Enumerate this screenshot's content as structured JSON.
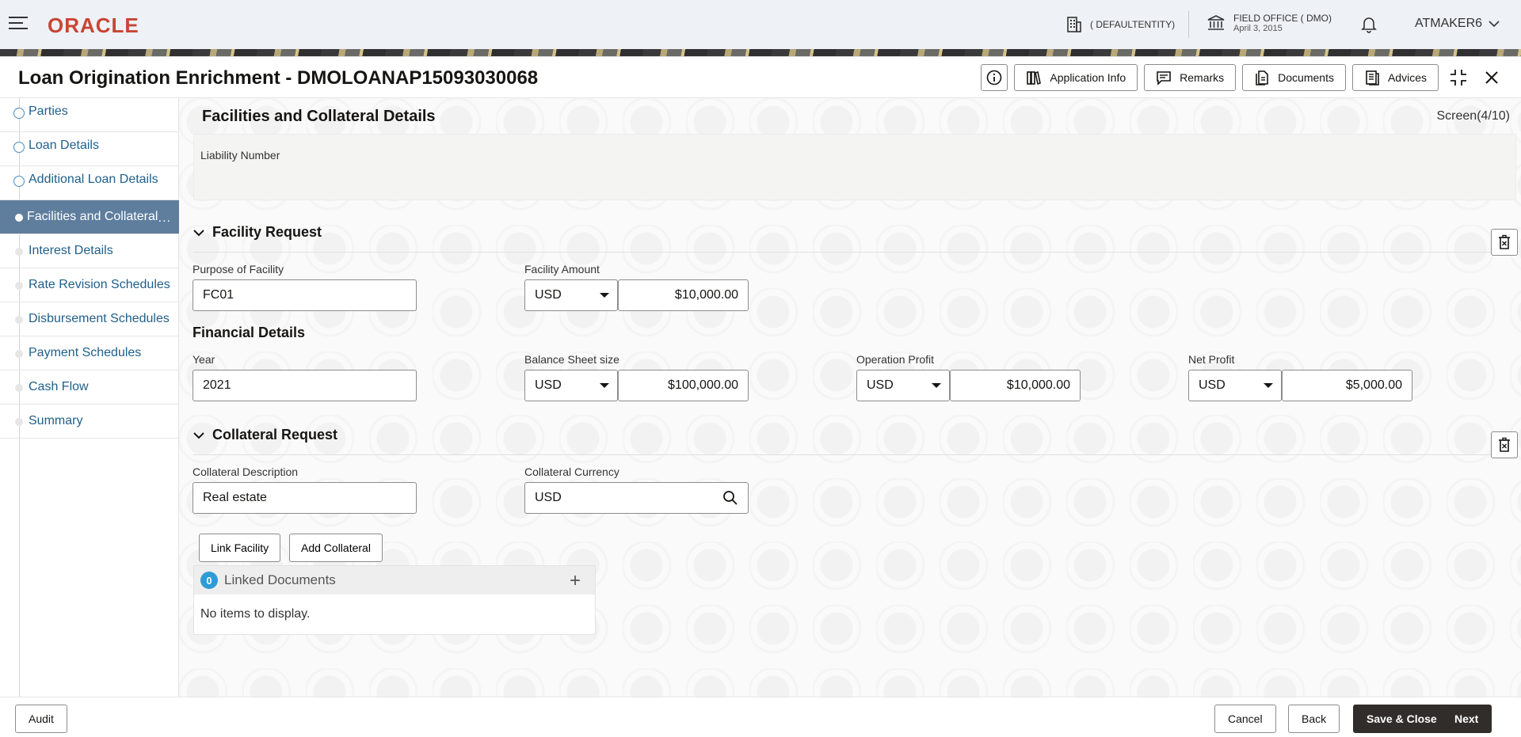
{
  "header": {
    "logo": "ORACLE",
    "entity": "( DEFAULTENTITY)",
    "office": "FIELD OFFICE ( DMO)",
    "office_date": "April 3, 2015",
    "user": "ATMAKER6"
  },
  "window": {
    "title": "Loan Origination Enrichment - DMOLOANAP15093030068",
    "actions": {
      "info_icon": "info-icon",
      "application_info": "Application Info",
      "remarks": "Remarks",
      "documents": "Documents",
      "advices": "Advices"
    }
  },
  "nav": {
    "items": [
      {
        "label": "Parties",
        "state": "done"
      },
      {
        "label": "Loan Details",
        "state": "done"
      },
      {
        "label": "Additional Loan Details",
        "state": "done"
      },
      {
        "label": "Facilities and Collateral",
        "state": "active"
      },
      {
        "label": "Interest Details",
        "state": "todo"
      },
      {
        "label": "Rate Revision Schedules",
        "state": "todo"
      },
      {
        "label": "Disbursement Schedules",
        "state": "todo"
      },
      {
        "label": "Payment Schedules",
        "state": "todo"
      },
      {
        "label": "Cash Flow",
        "state": "todo"
      },
      {
        "label": "Summary",
        "state": "todo"
      }
    ],
    "more": "..."
  },
  "main": {
    "title": "Facilities and Collateral Details",
    "screen": "Screen(4/10)",
    "liability_label": "Liability Number",
    "facility": {
      "heading": "Facility Request",
      "purpose_label": "Purpose of Facility",
      "purpose_value": "FC01",
      "amount_label": "Facility Amount",
      "amount_currency": "USD",
      "amount_value": "$10,000.00"
    },
    "financial": {
      "heading": "Financial Details",
      "year_label": "Year",
      "year_value": "2021",
      "balance_label": "Balance Sheet size",
      "balance_currency": "USD",
      "balance_value": "$100,000.00",
      "op_label": "Operation Profit",
      "op_currency": "USD",
      "op_value": "$10,000.00",
      "net_label": "Net Profit",
      "net_currency": "USD",
      "net_value": "$5,000.00"
    },
    "collateral": {
      "heading": "Collateral Request",
      "desc_label": "Collateral Description",
      "desc_value": "Real estate",
      "currency_label": "Collateral Currency",
      "currency_value": "USD",
      "link_facility": "Link Facility",
      "add_collateral": "Add Collateral"
    },
    "linked_documents": {
      "count": "0",
      "title": "Linked Documents",
      "empty": "No items to display."
    }
  },
  "footer": {
    "audit": "Audit",
    "cancel": "Cancel",
    "back": "Back",
    "save_close": "Save & Close",
    "next": "Next"
  }
}
